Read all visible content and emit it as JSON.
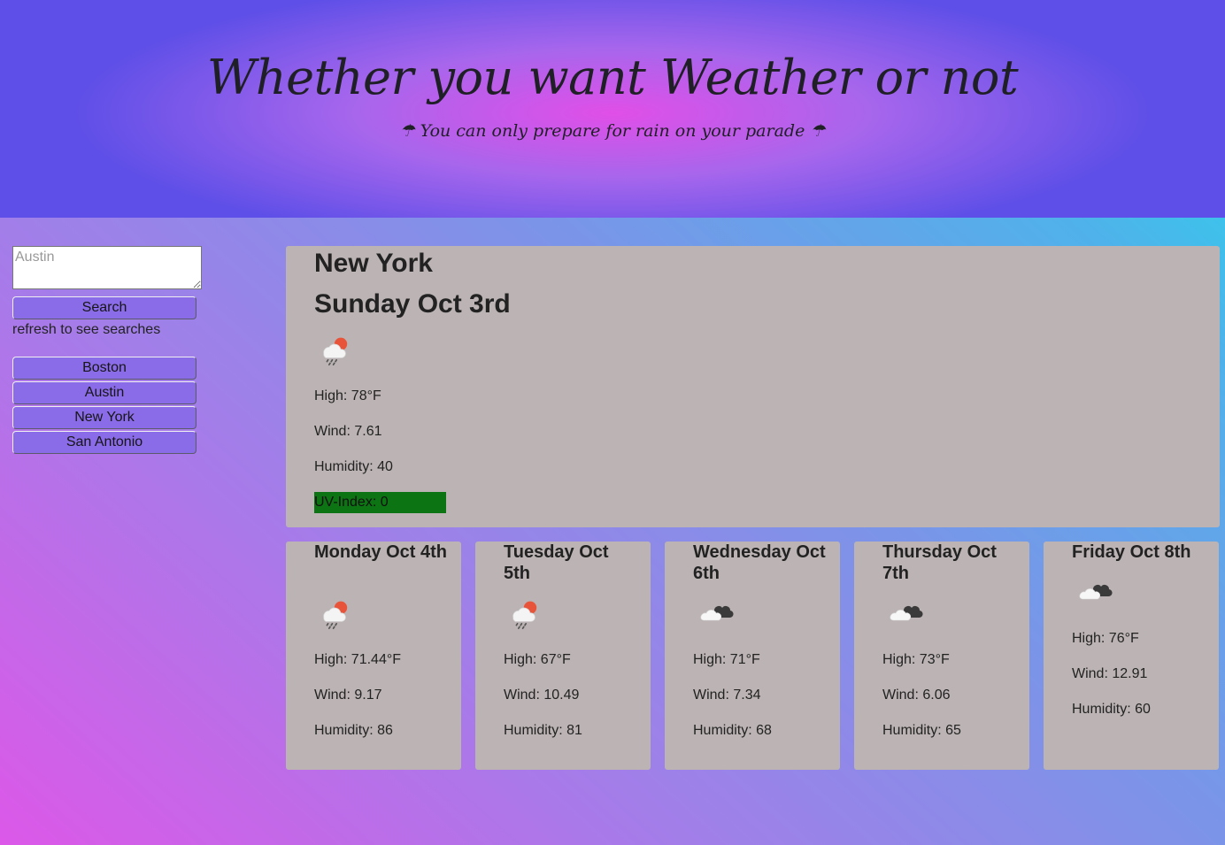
{
  "header": {
    "title": "Whether you want Weather or not",
    "subtitle": "☂ You can only prepare for rain on your parade ☂"
  },
  "sidebar": {
    "search_placeholder": "Austin",
    "search_button": "Search",
    "hint": "refresh to see searches",
    "history": [
      "Boston",
      "Austin",
      "New York",
      "San Antonio"
    ]
  },
  "current": {
    "city": "New York",
    "date": "Sunday Oct 3rd",
    "icon": "rain-sun-icon",
    "high": "High: 78°F",
    "wind": "Wind: 7.61",
    "humidity": "Humidity: 40",
    "uv": "UV-Index: 0",
    "uv_color": "#0c7413"
  },
  "forecast": [
    {
      "date": "Monday Oct 4th",
      "icon": "rain-sun-icon",
      "high": "High: 71.44°F",
      "wind": "Wind: 9.17",
      "humidity": "Humidity: 86"
    },
    {
      "date": "Tuesday Oct 5th",
      "icon": "rain-sun-icon",
      "high": "High: 67°F",
      "wind": "Wind: 10.49",
      "humidity": "Humidity: 81"
    },
    {
      "date": "Wednesday Oct 6th",
      "icon": "clouds-icon",
      "high": "High: 71°F",
      "wind": "Wind: 7.34",
      "humidity": "Humidity: 68"
    },
    {
      "date": "Thursday Oct 7th",
      "icon": "clouds-icon",
      "high": "High: 73°F",
      "wind": "Wind: 6.06",
      "humidity": "Humidity: 65"
    },
    {
      "date": "Friday Oct 8th",
      "icon": "clouds-icon",
      "high": "High: 76°F",
      "wind": "Wind: 12.91",
      "humidity": "Humidity: 60"
    }
  ]
}
